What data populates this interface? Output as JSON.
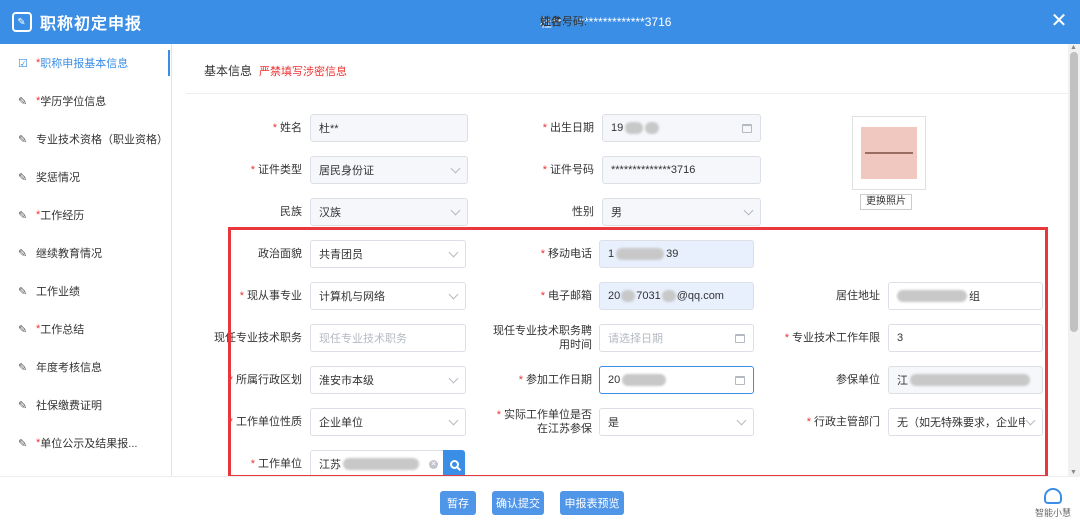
{
  "header": {
    "title": "职称初定申报",
    "name_label": "姓名:",
    "name_value": "杜**",
    "id_label": "证件号码:",
    "id_value": "**************3716"
  },
  "sidebar": {
    "items": [
      {
        "label": "职称申报基本信息",
        "required": true,
        "active": true
      },
      {
        "label": "学历学位信息",
        "required": true
      },
      {
        "label": "专业技术资格（职业资格）",
        "required": false
      },
      {
        "label": "奖惩情况",
        "required": false
      },
      {
        "label": "工作经历",
        "required": true
      },
      {
        "label": "继续教育情况",
        "required": false
      },
      {
        "label": "工作业绩",
        "required": false
      },
      {
        "label": "工作总结",
        "required": true
      },
      {
        "label": "年度考核信息",
        "required": false
      },
      {
        "label": "社保缴费证明",
        "required": false
      },
      {
        "label": "单位公示及结果报...",
        "required": true
      }
    ]
  },
  "section": {
    "title": "基本信息",
    "warning": "严禁填写涉密信息"
  },
  "form": {
    "name_label": "姓名",
    "name_value": "杜**",
    "birth_label": "出生日期",
    "birth_value": "19",
    "idtype_label": "证件类型",
    "idtype_value": "居民身份证",
    "idno_label": "证件号码",
    "idno_value": "**************3716",
    "ethnic_label": "民族",
    "ethnic_value": "汉族",
    "gender_label": "性别",
    "gender_value": "男",
    "political_label": "政治面貌",
    "political_value": "共青团员",
    "mobile_label": "移动电话",
    "mobile_value_prefix": "1",
    "mobile_value_suffix": "39",
    "specialty_label": "现从事专业",
    "specialty_value": "计算机与网络",
    "email_label": "电子邮箱",
    "email_value_prefix": "20",
    "email_value_mid": "7031",
    "email_value_suffix": "@qq.com",
    "address_label": "居住地址",
    "address_value_suffix": "组",
    "position_label": "现任专业技术职务",
    "position_placeholder": "现任专业技术职务",
    "appoint_label_1": "现任专业技术职务聘",
    "appoint_label_2": "用时间",
    "appoint_placeholder": "请选择日期",
    "years_label": "专业技术工作年限",
    "years_value": "3",
    "region_label": "所属行政区划",
    "region_value": "淮安市本级",
    "workdate_label": "参加工作日期",
    "workdate_value": "20",
    "insure_label": "参保单位",
    "insure_value_prefix": "江",
    "unittype_label": "工作单位性质",
    "unittype_value": "企业单位",
    "jsinsure_label_1": "实际工作单位是否",
    "jsinsure_label_2": "在江苏参保",
    "jsinsure_value": "是",
    "admin_label": "行政主管部门",
    "admin_value": "无（如无特殊要求，企业申...",
    "employer_label": "工作单位",
    "employer_value_prefix": "江苏"
  },
  "photo": {
    "change_label": "更换照片"
  },
  "footer": {
    "save_label": "暂存",
    "submit_label": "确认提交",
    "preview_label": "申报表预览",
    "assistant_label": "智能小慧"
  }
}
